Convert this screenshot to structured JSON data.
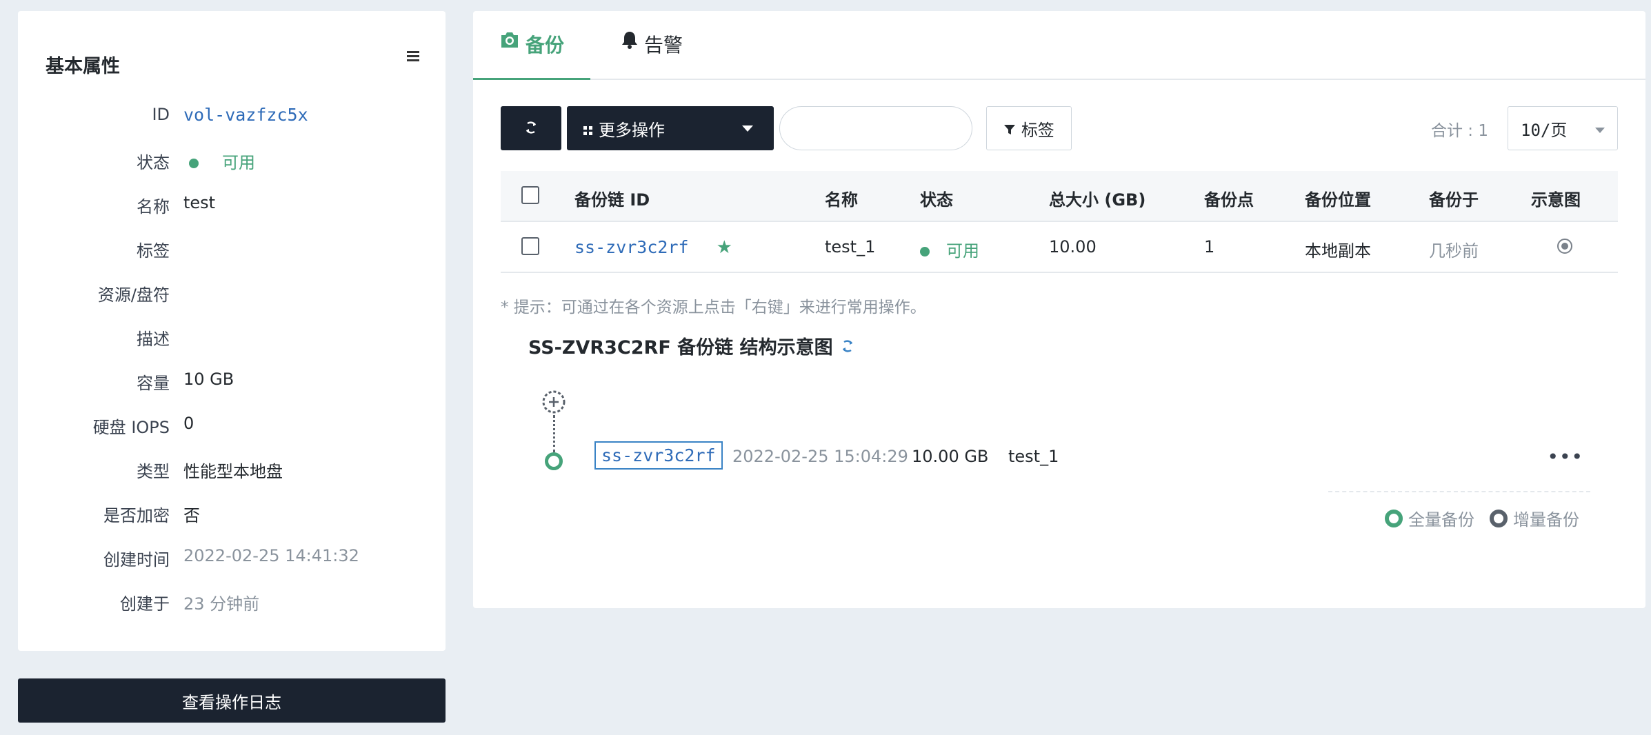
{
  "left_panel": {
    "title": "基本属性",
    "props": [
      {
        "label": "ID",
        "value": "vol-vazfzc5x"
      },
      {
        "label": "状态",
        "value": "可用"
      },
      {
        "label": "名称",
        "value": "test"
      },
      {
        "label": "标签",
        "value": ""
      },
      {
        "label": "资源/盘符",
        "value": ""
      },
      {
        "label": "描述",
        "value": ""
      },
      {
        "label": "容量",
        "value": "10 GB"
      },
      {
        "label": "硬盘 IOPS",
        "value": "0"
      },
      {
        "label": "类型",
        "value": "性能型本地盘"
      },
      {
        "label": "是否加密",
        "value": "否"
      },
      {
        "label": "创建时间",
        "value": "2022-02-25 14:41:32"
      },
      {
        "label": "创建于",
        "value": "23 分钟前"
      }
    ],
    "log_button": "查看操作日志"
  },
  "tabs": [
    {
      "label": "备份",
      "icon": "camera-icon",
      "active": true
    },
    {
      "label": "告警",
      "icon": "bell-icon",
      "active": false
    }
  ],
  "toolbar": {
    "more_label": "更多操作",
    "search_value": "",
    "tag_label": "标签",
    "total": "合计 : 1",
    "page_size": "10/页"
  },
  "table": {
    "headers": [
      "备份链 ID",
      "名称",
      "状态",
      "总大小 (GB)",
      "备份点",
      "备份位置",
      "备份于",
      "示意图"
    ],
    "rows": [
      {
        "id": "ss-zvr3c2rf",
        "name": "test_1",
        "status": "可用",
        "size": "10.00",
        "points": "1",
        "location": "本地副本",
        "time": "几秒前"
      }
    ]
  },
  "tip": "* 提示：可通过在各个资源上点击「右键」来进行常用操作。",
  "chain": {
    "title": "SS-ZVR3C2RF 备份链 结构示意图",
    "node": {
      "id": "ss-zvr3c2rf",
      "time": "2022-02-25 15:04:29",
      "size": "10.00 GB",
      "name": "test_1"
    },
    "legend": {
      "full": "全量备份",
      "incremental": "增量备份"
    }
  },
  "colors": {
    "accent": "#46a37a",
    "link": "#2e6bb8",
    "dark": "#1b2330"
  }
}
